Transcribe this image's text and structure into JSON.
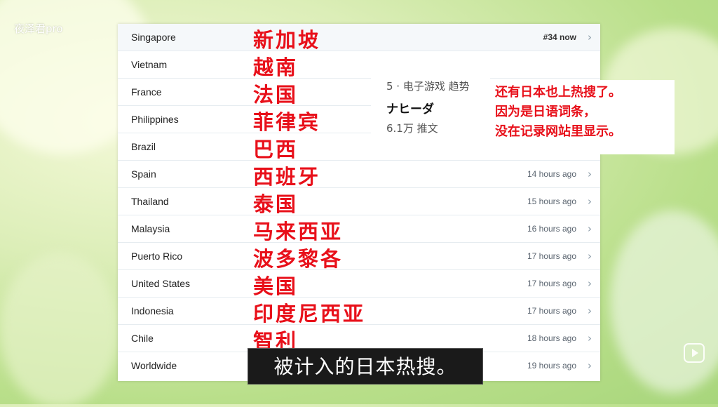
{
  "watermark": "夜泽君pro",
  "rows": [
    {
      "country": "Singapore",
      "zh": "新加坡",
      "time": "#34 now"
    },
    {
      "country": "Vietnam",
      "zh": "越南",
      "time": ""
    },
    {
      "country": "France",
      "zh": "法国",
      "time": ""
    },
    {
      "country": "Philippines",
      "zh": "菲律宾",
      "time": ""
    },
    {
      "country": "Brazil",
      "zh": "巴西",
      "time": ""
    },
    {
      "country": "Spain",
      "zh": "西班牙",
      "time": "14 hours ago"
    },
    {
      "country": "Thailand",
      "zh": "泰国",
      "time": "15 hours ago"
    },
    {
      "country": "Malaysia",
      "zh": "马来西亚",
      "time": "16 hours ago"
    },
    {
      "country": "Puerto Rico",
      "zh": "波多黎各",
      "time": "17 hours ago"
    },
    {
      "country": "United States",
      "zh": "美国",
      "time": "17 hours ago"
    },
    {
      "country": "Indonesia",
      "zh": "印度尼西亚",
      "time": "17 hours ago"
    },
    {
      "country": "Chile",
      "zh": "智利",
      "time": "18 hours ago"
    },
    {
      "country": "Worldwide",
      "zh": "",
      "time": "19 hours ago"
    }
  ],
  "trend_card": {
    "meta": "5 · 电子游戏 趋势",
    "name": "ナヒーダ",
    "count": "6.1万 推文"
  },
  "note": {
    "line1": "还有日本也上热搜了。",
    "line2": "因为是日语词条，",
    "line3": "没在记录网站里显示。"
  },
  "subtitle": "被计入的日本热搜。",
  "chevron": "›",
  "colors": {
    "annotation_red": "#e8101a",
    "subtitle_bg": "#1a1a1a"
  }
}
